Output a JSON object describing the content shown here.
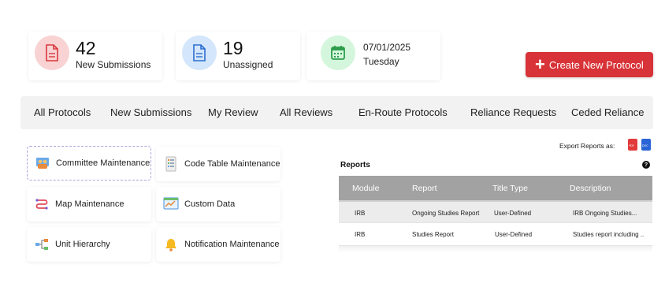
{
  "stats": {
    "new_submissions": {
      "count": "42",
      "label": "New Submissions",
      "icon": "document-icon",
      "color": "#f9d3d3",
      "icon_color": "#d9383d"
    },
    "unassigned": {
      "count": "19",
      "label": "Unassigned",
      "icon": "document-icon",
      "color": "#d3e6fb",
      "icon_color": "#2d6fd0"
    },
    "date": {
      "date": "07/01/2025",
      "day": "Tuesday",
      "icon": "calendar-icon",
      "color": "#d4f6dc",
      "icon_color": "#2e9e4d"
    }
  },
  "create_button": {
    "label": "Create New Protocol",
    "color": "#d83338"
  },
  "tabs": [
    {
      "label": "All Protocols"
    },
    {
      "label": "New Submissions"
    },
    {
      "label": "My Review"
    },
    {
      "label": "All Reviews"
    },
    {
      "label": "En-Route Protocols"
    },
    {
      "label": "Reliance Requests"
    },
    {
      "label": "Ceded Reliance"
    }
  ],
  "maintenance": [
    {
      "label": "Committee Maintenance",
      "icon": "committee-icon"
    },
    {
      "label": "Code Table Maintenance",
      "icon": "code-table-icon"
    },
    {
      "label": "Map Maintenance",
      "icon": "map-route-icon"
    },
    {
      "label": "Custom Data",
      "icon": "chart-board-icon"
    },
    {
      "label": "Unit Hierarchy",
      "icon": "hierarchy-icon"
    },
    {
      "label": "Notification Maintenance",
      "icon": "bell-icon"
    }
  ],
  "export": {
    "label": "Export Reports as:",
    "pdf": "PDF",
    "doc": "DOC"
  },
  "reports": {
    "title": "Reports",
    "help": "?",
    "columns": [
      "Module",
      "Report",
      "Title Type",
      "Description"
    ],
    "rows": [
      [
        "IRB",
        "Ongoing Studies Report",
        "User-Defined",
        "IRB Ongoing Studies..."
      ],
      [
        "IRB",
        "Studies Report",
        "User-Defined",
        "Studies report including .."
      ]
    ]
  }
}
